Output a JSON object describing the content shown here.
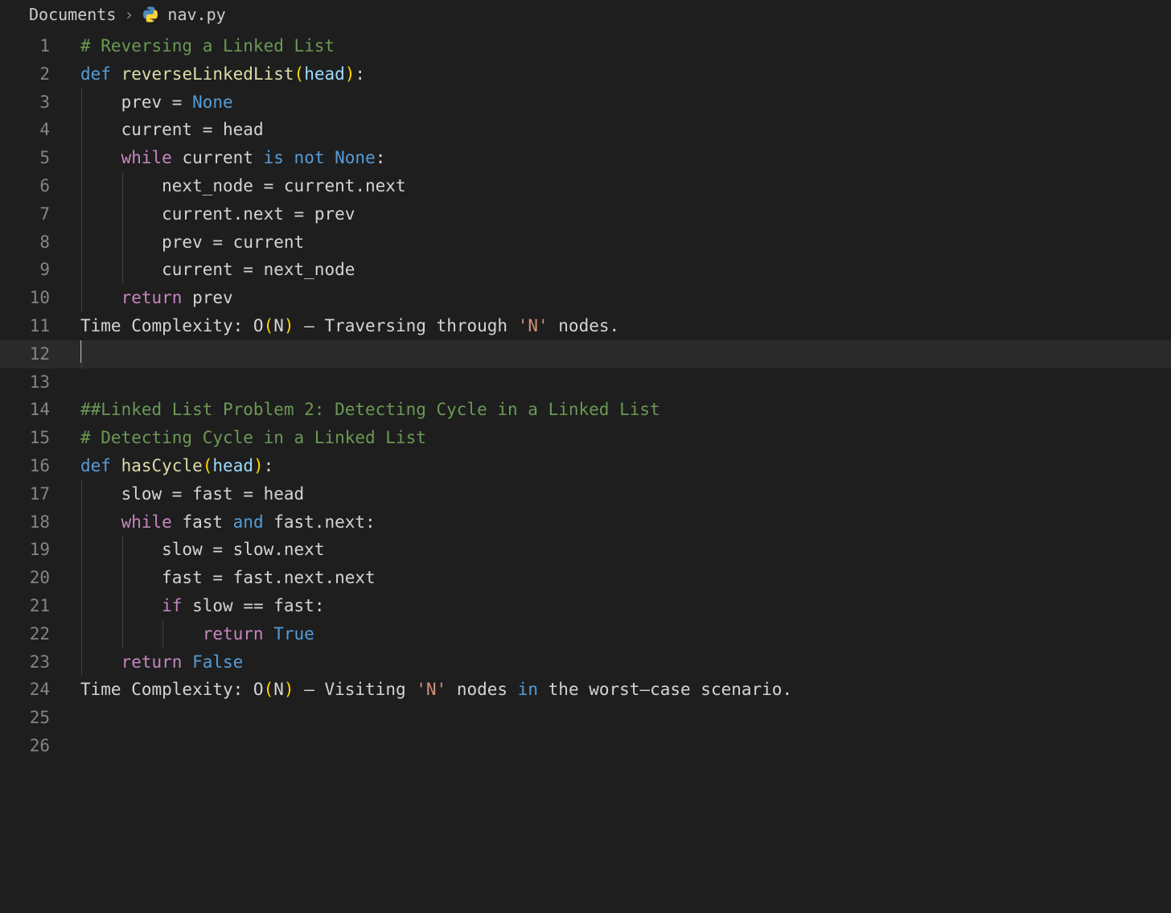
{
  "breadcrumb": {
    "folder": "Documents",
    "separator": "›",
    "filename": "nav.py",
    "icon": "python-icon"
  },
  "editor": {
    "active_line": 12,
    "lines": [
      {
        "n": 1,
        "indent_guides": [],
        "tokens": [
          {
            "c": "c-comment",
            "t": "# Reversing a Linked List"
          }
        ]
      },
      {
        "n": 2,
        "indent_guides": [],
        "tokens": [
          {
            "c": "c-keyword",
            "t": "def"
          },
          {
            "c": "c-plain",
            "t": " "
          },
          {
            "c": "c-func",
            "t": "reverseLinkedList"
          },
          {
            "c": "c-paren-y",
            "t": "("
          },
          {
            "c": "c-param",
            "t": "head"
          },
          {
            "c": "c-paren-y",
            "t": ")"
          },
          {
            "c": "c-plain",
            "t": ":"
          }
        ]
      },
      {
        "n": 3,
        "indent_guides": [
          0
        ],
        "tokens": [
          {
            "c": "c-plain",
            "t": "    prev "
          },
          {
            "c": "c-op",
            "t": "="
          },
          {
            "c": "c-plain",
            "t": " "
          },
          {
            "c": "c-const",
            "t": "None"
          }
        ]
      },
      {
        "n": 4,
        "indent_guides": [
          0
        ],
        "tokens": [
          {
            "c": "c-plain",
            "t": "    current "
          },
          {
            "c": "c-op",
            "t": "="
          },
          {
            "c": "c-plain",
            "t": " head"
          }
        ]
      },
      {
        "n": 5,
        "indent_guides": [
          0
        ],
        "tokens": [
          {
            "c": "c-plain",
            "t": "    "
          },
          {
            "c": "c-control",
            "t": "while"
          },
          {
            "c": "c-plain",
            "t": " current "
          },
          {
            "c": "c-keyword",
            "t": "is"
          },
          {
            "c": "c-plain",
            "t": " "
          },
          {
            "c": "c-keyword",
            "t": "not"
          },
          {
            "c": "c-plain",
            "t": " "
          },
          {
            "c": "c-const",
            "t": "None"
          },
          {
            "c": "c-plain",
            "t": ":"
          }
        ]
      },
      {
        "n": 6,
        "indent_guides": [
          0,
          1
        ],
        "tokens": [
          {
            "c": "c-plain",
            "t": "        next_node "
          },
          {
            "c": "c-op",
            "t": "="
          },
          {
            "c": "c-plain",
            "t": " current.next"
          }
        ]
      },
      {
        "n": 7,
        "indent_guides": [
          0,
          1
        ],
        "tokens": [
          {
            "c": "c-plain",
            "t": "        current.next "
          },
          {
            "c": "c-op",
            "t": "="
          },
          {
            "c": "c-plain",
            "t": " prev"
          }
        ]
      },
      {
        "n": 8,
        "indent_guides": [
          0,
          1
        ],
        "tokens": [
          {
            "c": "c-plain",
            "t": "        prev "
          },
          {
            "c": "c-op",
            "t": "="
          },
          {
            "c": "c-plain",
            "t": " current"
          }
        ]
      },
      {
        "n": 9,
        "indent_guides": [
          0,
          1
        ],
        "tokens": [
          {
            "c": "c-plain",
            "t": "        current "
          },
          {
            "c": "c-op",
            "t": "="
          },
          {
            "c": "c-plain",
            "t": " next_node"
          }
        ]
      },
      {
        "n": 10,
        "indent_guides": [
          0
        ],
        "tokens": [
          {
            "c": "c-plain",
            "t": "    "
          },
          {
            "c": "c-control",
            "t": "return"
          },
          {
            "c": "c-plain",
            "t": " prev"
          }
        ]
      },
      {
        "n": 11,
        "indent_guides": [],
        "tokens": [
          {
            "c": "c-plain",
            "t": "Time Complexity: O"
          },
          {
            "c": "c-paren-y",
            "t": "("
          },
          {
            "c": "c-plain",
            "t": "N"
          },
          {
            "c": "c-paren-y",
            "t": ")"
          },
          {
            "c": "c-plain",
            "t": " — Traversing through "
          },
          {
            "c": "c-str",
            "t": "'N'"
          },
          {
            "c": "c-plain",
            "t": " nodes."
          }
        ]
      },
      {
        "n": 12,
        "indent_guides": [
          0
        ],
        "cursor": true,
        "tokens": []
      },
      {
        "n": 13,
        "indent_guides": [],
        "tokens": []
      },
      {
        "n": 14,
        "indent_guides": [],
        "tokens": [
          {
            "c": "c-comment",
            "t": "##Linked List Problem 2: Detecting Cycle in a Linked List"
          }
        ]
      },
      {
        "n": 15,
        "indent_guides": [],
        "tokens": [
          {
            "c": "c-comment",
            "t": "# Detecting Cycle in a Linked List"
          }
        ]
      },
      {
        "n": 16,
        "indent_guides": [],
        "tokens": [
          {
            "c": "c-keyword",
            "t": "def"
          },
          {
            "c": "c-plain",
            "t": " "
          },
          {
            "c": "c-func",
            "t": "hasCycle"
          },
          {
            "c": "c-paren-y",
            "t": "("
          },
          {
            "c": "c-param",
            "t": "head"
          },
          {
            "c": "c-paren-y",
            "t": ")"
          },
          {
            "c": "c-plain",
            "t": ":"
          }
        ]
      },
      {
        "n": 17,
        "indent_guides": [
          0
        ],
        "tokens": [
          {
            "c": "c-plain",
            "t": "    slow "
          },
          {
            "c": "c-op",
            "t": "="
          },
          {
            "c": "c-plain",
            "t": " fast "
          },
          {
            "c": "c-op",
            "t": "="
          },
          {
            "c": "c-plain",
            "t": " head"
          }
        ]
      },
      {
        "n": 18,
        "indent_guides": [
          0
        ],
        "tokens": [
          {
            "c": "c-plain",
            "t": "    "
          },
          {
            "c": "c-control",
            "t": "while"
          },
          {
            "c": "c-plain",
            "t": " fast "
          },
          {
            "c": "c-keyword",
            "t": "and"
          },
          {
            "c": "c-plain",
            "t": " fast.next:"
          }
        ]
      },
      {
        "n": 19,
        "indent_guides": [
          0,
          1
        ],
        "tokens": [
          {
            "c": "c-plain",
            "t": "        slow "
          },
          {
            "c": "c-op",
            "t": "="
          },
          {
            "c": "c-plain",
            "t": " slow.next"
          }
        ]
      },
      {
        "n": 20,
        "indent_guides": [
          0,
          1
        ],
        "tokens": [
          {
            "c": "c-plain",
            "t": "        fast "
          },
          {
            "c": "c-op",
            "t": "="
          },
          {
            "c": "c-plain",
            "t": " fast.next.next"
          }
        ]
      },
      {
        "n": 21,
        "indent_guides": [
          0,
          1
        ],
        "tokens": [
          {
            "c": "c-plain",
            "t": "        "
          },
          {
            "c": "c-control",
            "t": "if"
          },
          {
            "c": "c-plain",
            "t": " slow "
          },
          {
            "c": "c-op",
            "t": "=="
          },
          {
            "c": "c-plain",
            "t": " fast:"
          }
        ]
      },
      {
        "n": 22,
        "indent_guides": [
          0,
          1,
          2
        ],
        "tokens": [
          {
            "c": "c-plain",
            "t": "            "
          },
          {
            "c": "c-control",
            "t": "return"
          },
          {
            "c": "c-plain",
            "t": " "
          },
          {
            "c": "c-const",
            "t": "True"
          }
        ]
      },
      {
        "n": 23,
        "indent_guides": [
          0
        ],
        "tokens": [
          {
            "c": "c-plain",
            "t": "    "
          },
          {
            "c": "c-control",
            "t": "return"
          },
          {
            "c": "c-plain",
            "t": " "
          },
          {
            "c": "c-const",
            "t": "False"
          }
        ]
      },
      {
        "n": 24,
        "indent_guides": [],
        "tokens": [
          {
            "c": "c-plain",
            "t": "Time Complexity: O"
          },
          {
            "c": "c-paren-y",
            "t": "("
          },
          {
            "c": "c-plain",
            "t": "N"
          },
          {
            "c": "c-paren-y",
            "t": ")"
          },
          {
            "c": "c-plain",
            "t": " — Visiting "
          },
          {
            "c": "c-str",
            "t": "'N'"
          },
          {
            "c": "c-plain",
            "t": " nodes "
          },
          {
            "c": "c-keyword",
            "t": "in"
          },
          {
            "c": "c-plain",
            "t": " the worst—case scenario."
          }
        ]
      },
      {
        "n": 25,
        "indent_guides": [],
        "tokens": []
      },
      {
        "n": 26,
        "indent_guides": [],
        "tokens": []
      }
    ]
  }
}
